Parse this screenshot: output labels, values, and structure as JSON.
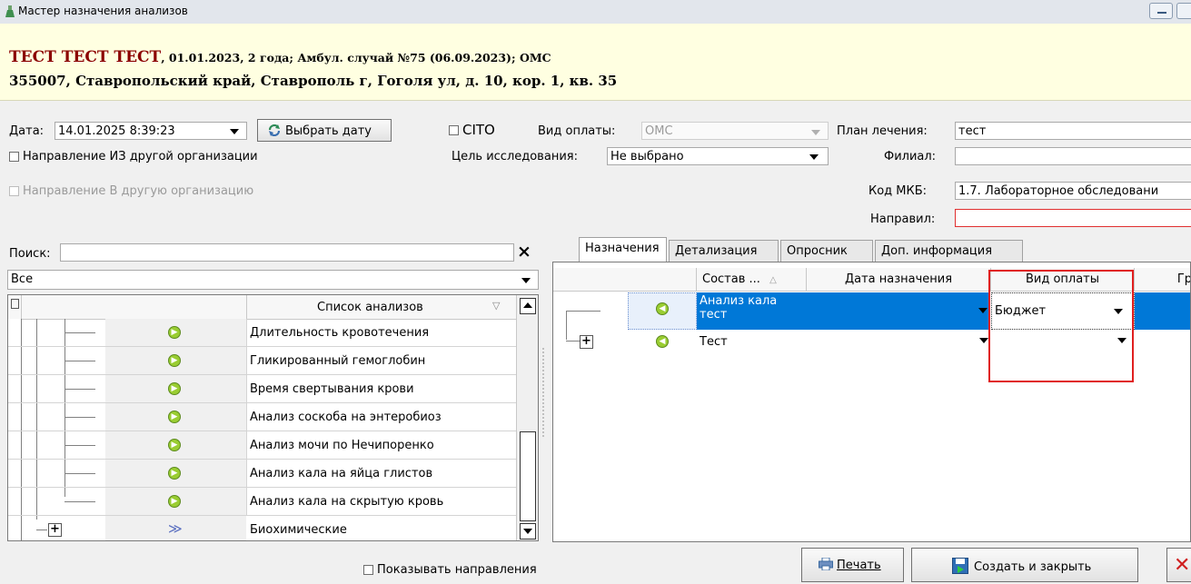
{
  "window": {
    "title": "Мастер назначения анализов"
  },
  "patient": {
    "name": "ТЕСТ ТЕСТ ТЕСТ",
    "info": ", 01.01.2023, 2 года; Амбул. случай №75 (06.09.2023); ОМС",
    "address": "355007, Ставропольский край, Ставрополь г, Гоголя ул, д. 10, кор. 1, кв. 35"
  },
  "form": {
    "date_label": "Дата:",
    "date_value": "14.01.2025 8:39:23",
    "choose_date_button": "Выбрать дату",
    "cito_label": "CITO",
    "payment_label": "Вид оплаты:",
    "payment_value": "ОМС",
    "plan_label": "План лечения:",
    "plan_value": "тест",
    "from_org_label": "Направление ИЗ другой организации",
    "to_org_label": "Направление В другую организацию",
    "purpose_label": "Цель исследования:",
    "purpose_value": "Не выбрано",
    "branch_label": "Филиал:",
    "branch_value": "",
    "mkb_label": "Код МКБ:",
    "mkb_value": "1.7. Лабораторное обследовани",
    "directed_label": "Направил:",
    "directed_value": ""
  },
  "search": {
    "label": "Поиск:",
    "value": "",
    "clear": "×",
    "filter_value": "Все"
  },
  "analysis_list": {
    "header": "Список анализов",
    "items": [
      "Длительность кровотечения",
      "Гликированный гемоглобин",
      "Время свертывания крови",
      "Анализ соскоба на энтеробиоз",
      "Анализ мочи по Нечипоренко",
      "Анализ кала на яйца глистов",
      "Анализ кала на скрытую кровь"
    ],
    "group_item": "Биохимические"
  },
  "tabs": [
    "Назначения",
    "Детализация",
    "Опросник",
    "Доп. информация"
  ],
  "assignments": {
    "columns": {
      "composition": "Состав ...",
      "date": "Дата назначения",
      "payment": "Вид оплаты",
      "group": "Гр"
    },
    "rows": [
      {
        "name_line1": "Анализ кала",
        "name_line2": "тест",
        "payment": "Бюджет"
      },
      {
        "name_line1": "Тест",
        "name_line2": "",
        "payment": ""
      }
    ]
  },
  "footer": {
    "show_directions_label": "Показывать направления",
    "print_button": "Печать",
    "create_close_button": "Создать и закрыть"
  }
}
